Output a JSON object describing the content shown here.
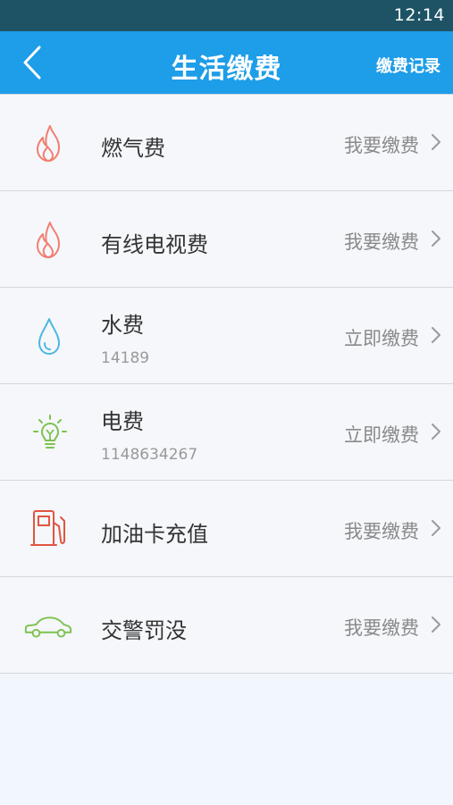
{
  "status": {
    "time": "12:14"
  },
  "header": {
    "title": "生活缴费",
    "record_label": "缴费记录"
  },
  "items": [
    {
      "name": "燃气费",
      "sub": "",
      "action": "我要缴费",
      "icon": "flame-icon",
      "color": "#f07f72"
    },
    {
      "name": "有线电视费",
      "sub": "",
      "action": "我要缴费",
      "icon": "flame-icon",
      "color": "#f07f72"
    },
    {
      "name": "水费",
      "sub": "14189",
      "action": "立即缴费",
      "icon": "water-drop-icon",
      "color": "#4cb6e3"
    },
    {
      "name": "电费",
      "sub": "1148634267",
      "action": "立即缴费",
      "icon": "light-bulb-icon",
      "color": "#7dc24e"
    },
    {
      "name": "加油卡充值",
      "sub": "",
      "action": "我要缴费",
      "icon": "fuel-pump-icon",
      "color": "#e0553f"
    },
    {
      "name": "交警罚没",
      "sub": "",
      "action": "我要缴费",
      "icon": "car-icon",
      "color": "#7dc24e"
    }
  ]
}
